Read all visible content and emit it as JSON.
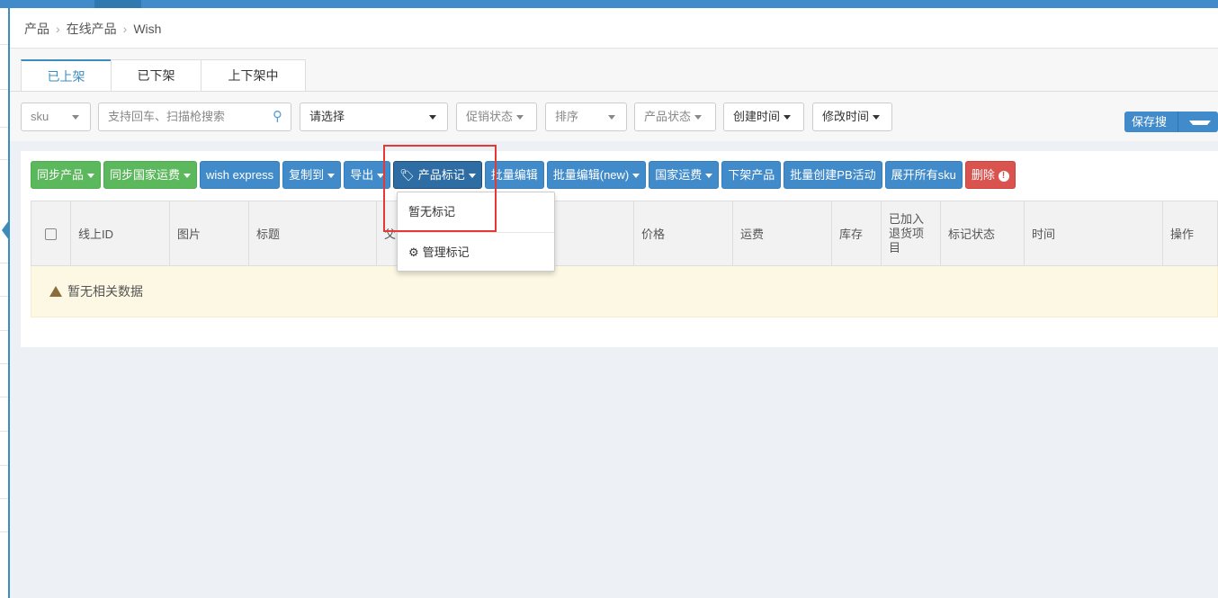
{
  "breadcrumb": [
    "产品",
    "在线产品",
    "Wish"
  ],
  "tabs": [
    {
      "label": "已上架",
      "active": true
    },
    {
      "label": "已下架"
    },
    {
      "label": "上下架中"
    }
  ],
  "filters": {
    "search_type": "sku",
    "search_placeholder": "支持回车、扫描枪搜索",
    "select": "请选择",
    "promo": "促销状态",
    "sort": "排序",
    "product_status": "产品状态",
    "created": "创建时间",
    "modified": "修改时间",
    "save_search": "保存搜索"
  },
  "actions": {
    "sync_products": "同步产品",
    "sync_shipping": "同步国家运费",
    "wish_express": "wish express",
    "copy_to": "复制到",
    "export": "导出",
    "product_tag": "产品标记",
    "batch_edit": "批量编辑",
    "batch_edit_new": "批量编辑(new)",
    "country_shipping": "国家运费",
    "delist": "下架产品",
    "batch_pb": "批量创建PB活动",
    "expand_sku": "展开所有sku",
    "delete": "删除"
  },
  "tag_menu": {
    "no_tag": "暂无标记",
    "manage": "管理标记"
  },
  "table": {
    "headers": [
      "线上ID",
      "图片",
      "标题",
      "父",
      "价格",
      "运费",
      "库存",
      "已加入退货项目",
      "标记状态",
      "时间",
      "操作"
    ],
    "empty": "暂无相关数据"
  },
  "colors": {
    "primary": "#428bca",
    "success": "#5cb85c",
    "danger": "#d9534f",
    "highlight": "#e53935"
  }
}
